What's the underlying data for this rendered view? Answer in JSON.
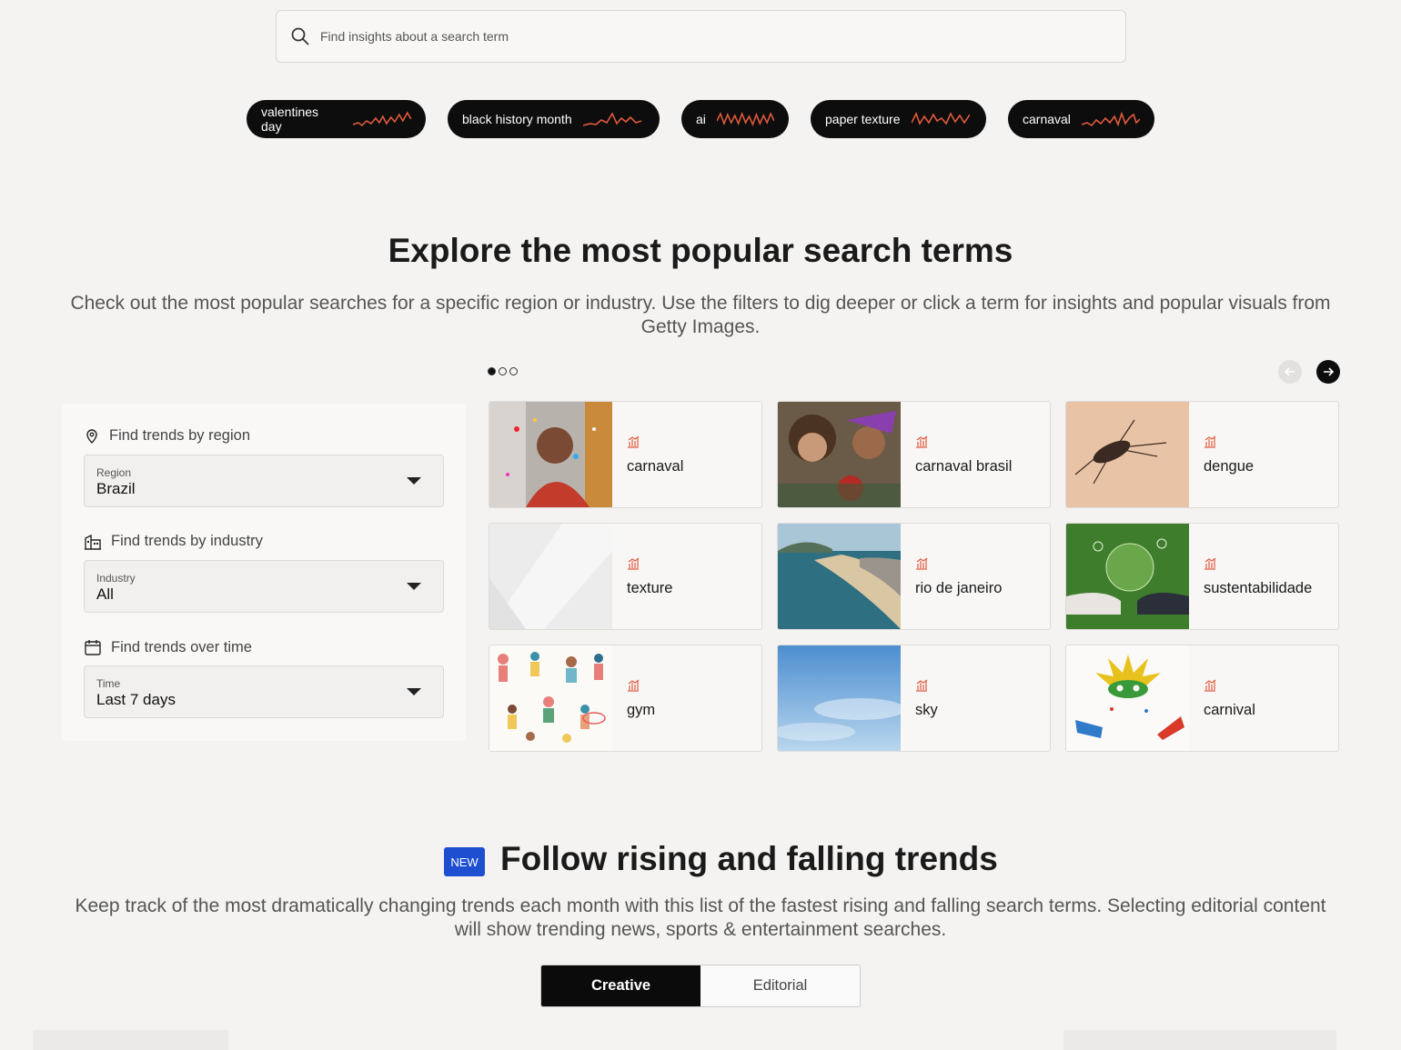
{
  "search": {
    "placeholder": "Find insights about a search term"
  },
  "trending_pills": [
    {
      "label": "valentines day"
    },
    {
      "label": "black history month"
    },
    {
      "label": "ai"
    },
    {
      "label": "paper texture"
    },
    {
      "label": "carnaval"
    }
  ],
  "explore": {
    "title": "Explore the most popular search terms",
    "subtitle_line1": "Check out the most popular searches for a specific region or industry. Use the filters to dig deeper or click a term for insights and popular visuals from",
    "subtitle_line2": "Getty Images."
  },
  "filters": {
    "region": {
      "heading": "Find trends by region",
      "caption": "Region",
      "value": "Brazil"
    },
    "industry": {
      "heading": "Find trends by industry",
      "caption": "Industry",
      "value": "All"
    },
    "time": {
      "heading": "Find trends over time",
      "caption": "Time",
      "value": "Last 7 days"
    }
  },
  "cards": [
    {
      "term": "carnaval"
    },
    {
      "term": "carnaval brasil"
    },
    {
      "term": "dengue"
    },
    {
      "term": "texture"
    },
    {
      "term": "rio de janeiro"
    },
    {
      "term": "sustentabilidade"
    },
    {
      "term": "gym"
    },
    {
      "term": "sky"
    },
    {
      "term": "carnival"
    }
  ],
  "follow": {
    "badge": "NEW",
    "title": "Follow rising and falling trends",
    "subtitle_line1": "Keep track of the most dramatically changing trends each month with this list of the fastest rising and falling search terms. Selecting editorial content",
    "subtitle_line2": "will show trending news, sports & entertainment searches.",
    "tabs": [
      "Creative",
      "Editorial"
    ]
  },
  "colors": {
    "accent": "#e05a3c",
    "badge": "#1f4fd1",
    "pill_bg": "#0d0d0d"
  },
  "icons": [
    "search-icon",
    "sparkline-icon",
    "location-pin-icon",
    "building-icon",
    "calendar-icon",
    "chart-icon",
    "arrow-left-icon",
    "arrow-right-icon"
  ]
}
